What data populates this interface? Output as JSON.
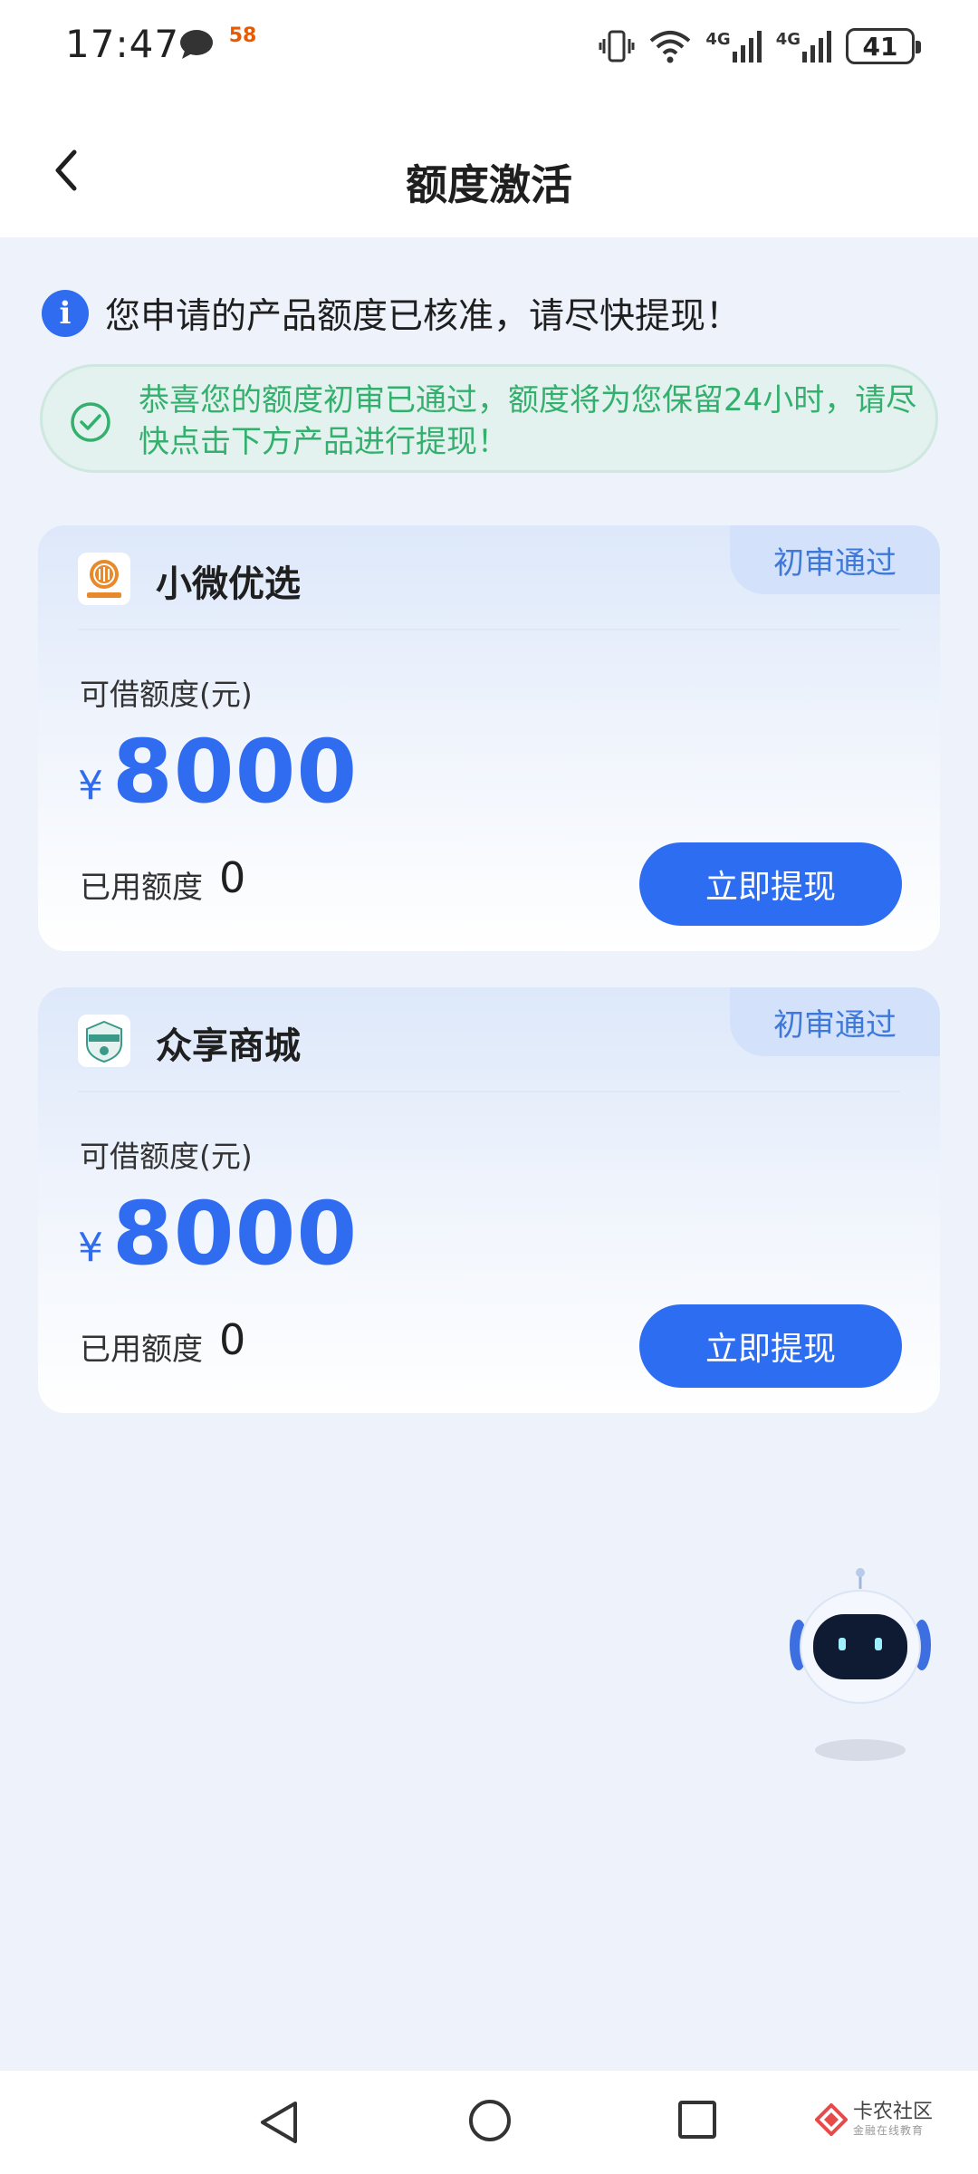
{
  "status_bar": {
    "time": "17:47",
    "app_badge": "58",
    "network_1": "4G",
    "network_2": "4G",
    "battery": "41"
  },
  "header": {
    "title": "额度激活"
  },
  "info": {
    "message": "您申请的产品额度已核准，请尽快提现！"
  },
  "notice": {
    "text": "恭喜您的额度初审已通过，额度将为您保留24小时，请尽快点击下方产品进行提现！"
  },
  "products": [
    {
      "name": "小微优选",
      "logo_text": "小微优选",
      "badge": "初审通过",
      "limit_label": "可借额度(元)",
      "currency": "¥",
      "amount": "8000",
      "used_label": "已用额度",
      "used_value": "0",
      "button": "立即提现"
    },
    {
      "name": "众享商城",
      "logo_text": "众享商城",
      "badge": "初审通过",
      "limit_label": "可借额度(元)",
      "currency": "¥",
      "amount": "8000",
      "used_label": "已用额度",
      "used_value": "0",
      "button": "立即提现"
    }
  ],
  "watermark": {
    "title": "卡农社区",
    "subtitle": "金融在线教育"
  },
  "colors": {
    "primary": "#2d6df2",
    "success": "#34b06e",
    "background": "#edf2fb"
  }
}
